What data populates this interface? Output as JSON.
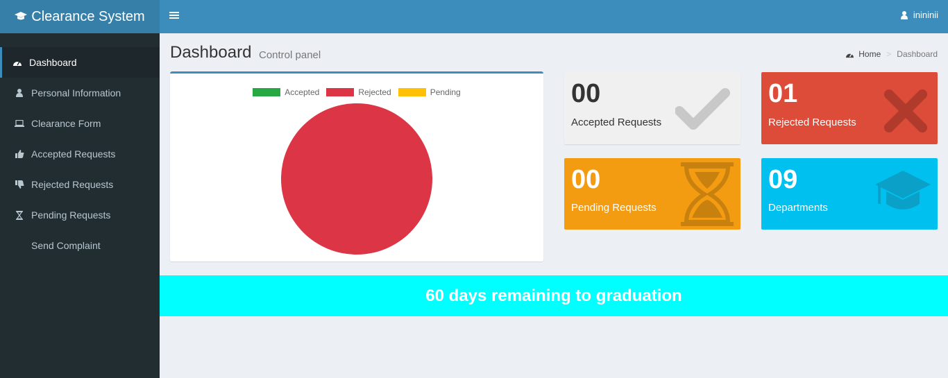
{
  "header": {
    "app_title": "Clearance System",
    "username": "inininii"
  },
  "sidebar": {
    "items": [
      {
        "label": "Dashboard",
        "icon": "dashboard-icon"
      },
      {
        "label": "Personal Information",
        "icon": "user-icon"
      },
      {
        "label": "Clearance Form",
        "icon": "laptop-icon"
      },
      {
        "label": "Accepted Requests",
        "icon": "thumbs-up-icon"
      },
      {
        "label": "Rejected Requests",
        "icon": "thumbs-down-icon"
      },
      {
        "label": "Pending Requests",
        "icon": "hourglass-icon"
      },
      {
        "label": "Send Complaint",
        "icon": ""
      }
    ]
  },
  "content": {
    "title": "Dashboard",
    "subtitle": "Control panel"
  },
  "breadcrumb": {
    "home": "Home",
    "sep": ">",
    "current": "Dashboard"
  },
  "chart_data": {
    "type": "pie",
    "categories": [
      "Accepted",
      "Rejected",
      "Pending"
    ],
    "values": [
      0,
      1,
      0
    ],
    "colors": [
      "#28a745",
      "#dc3545",
      "#ffc107"
    ],
    "legend": "top"
  },
  "stats": {
    "accepted": {
      "value": "00",
      "label": "Accepted Requests",
      "color": "#f0f0f0"
    },
    "rejected": {
      "value": "01",
      "label": "Rejected Requests",
      "color": "#dd4b39"
    },
    "pending": {
      "value": "00",
      "label": "Pending Requests",
      "color": "#f39c12"
    },
    "departments": {
      "value": "09",
      "label": "Departments",
      "color": "#00c0ef"
    }
  },
  "banner": {
    "text": "60 days remaining to graduation",
    "color": "#00ffff"
  }
}
